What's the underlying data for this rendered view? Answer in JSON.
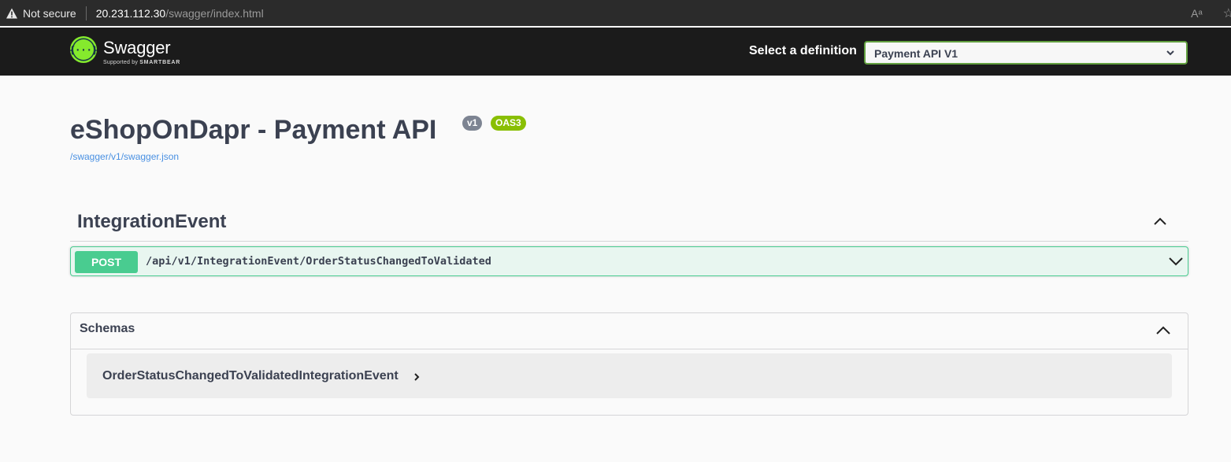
{
  "browser": {
    "security_label": "Not secure",
    "url_host": "20.231.112.30",
    "url_path": "/swagger/index.html",
    "read_aloud_label": "Aᵃ"
  },
  "topbar": {
    "logo_text": "Swagger",
    "logo_sub_prefix": "Supported by",
    "logo_sub_brand": "SMARTBEAR",
    "definition_label": "Select a definition",
    "definition_selected": "Payment API V1",
    "accent_color": "#62a03f"
  },
  "info": {
    "title": "eShopOnDapr - Payment API",
    "version_badge": "v1",
    "oas_badge": "OAS3",
    "spec_link": "/swagger/v1/swagger.json"
  },
  "tags": [
    {
      "name": "IntegrationEvent",
      "expanded": true,
      "operations": [
        {
          "method": "POST",
          "path": "/api/v1/IntegrationEvent/OrderStatusChangedToValidated",
          "color": "#49cc90"
        }
      ]
    }
  ],
  "schemas": {
    "title": "Schemas",
    "expanded": true,
    "models": [
      {
        "name": "OrderStatusChangedToValidatedIntegrationEvent"
      }
    ]
  }
}
